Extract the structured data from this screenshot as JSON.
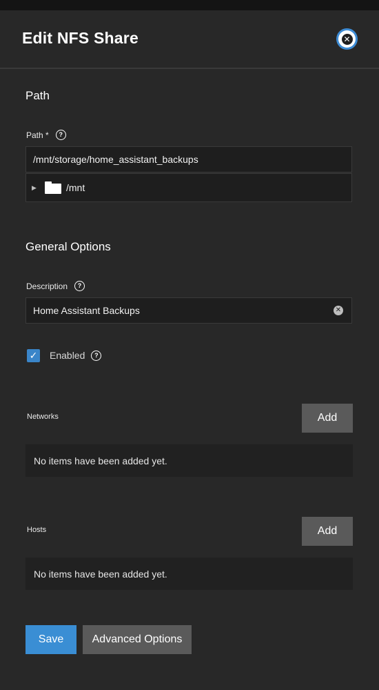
{
  "header": {
    "title": "Edit NFS Share",
    "close_icon": "close-icon"
  },
  "path_section": {
    "title": "Path",
    "label": "Path *",
    "value": "/mnt/storage/home_assistant_backups",
    "tree": {
      "expand_glyph": "▶",
      "folder_name": "/mnt"
    }
  },
  "general_section": {
    "title": "General Options",
    "description_label": "Description",
    "description_value": "Home Assistant Backups",
    "enabled_label": "Enabled",
    "enabled_checked": true
  },
  "networks": {
    "label": "Networks",
    "add_label": "Add",
    "empty_text": "No items have been added yet."
  },
  "hosts": {
    "label": "Hosts",
    "add_label": "Add",
    "empty_text": "No items have been added yet."
  },
  "footer": {
    "save_label": "Save",
    "advanced_label": "Advanced Options"
  },
  "colors": {
    "accent": "#3a8ed4",
    "background": "#282828",
    "field": "#1e1e1e",
    "button": "#5a5a5a"
  }
}
